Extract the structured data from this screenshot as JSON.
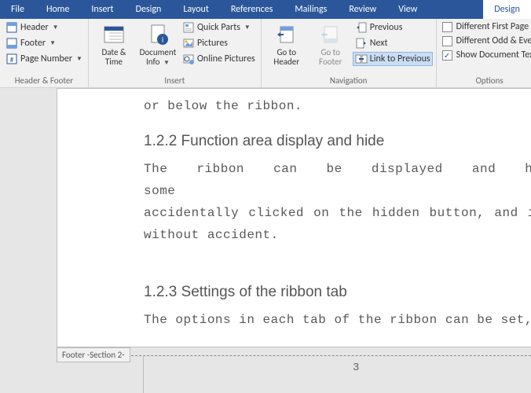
{
  "tabs": {
    "file": "File",
    "home": "Home",
    "insert": "Insert",
    "design": "Design",
    "layout": "Layout",
    "references": "References",
    "mailings": "Mailings",
    "review": "Review",
    "view": "View",
    "context_design": "Design"
  },
  "groups": {
    "header_footer": {
      "label": "Header & Footer",
      "header": "Header",
      "footer": "Footer",
      "page_number": "Page Number"
    },
    "insert": {
      "label": "Insert",
      "date_time": "Date & Time",
      "doc_info": "Document Info",
      "quick_parts": "Quick Parts",
      "pictures": "Pictures",
      "online_pictures": "Online Pictures"
    },
    "navigation": {
      "label": "Navigation",
      "goto_header": "Go to Header",
      "goto_footer": "Go to Footer",
      "previous": "Previous",
      "next": "Next",
      "link_previous": "Link to Previous"
    },
    "options": {
      "label": "Options",
      "diff_first": "Different First Page",
      "diff_odd_even": "Different Odd & Even",
      "show_doc_text": "Show Document Text",
      "show_doc_text_checked": true
    }
  },
  "document": {
    "line_top": "or below the ribbon.",
    "h2": "1.2.2 Function area display and hide",
    "p2a": "The ribbon can be displayed and hidden, some",
    "p2b": "accidentally clicked on the hidden button, and it is",
    "p2c": "without accident.",
    "h3": "1.2.3 Settings of the ribbon tab",
    "p3a": "The options in each tab of the ribbon can be set, eit",
    "footer_tag": "Footer -Section 2-",
    "page_num": "3"
  }
}
